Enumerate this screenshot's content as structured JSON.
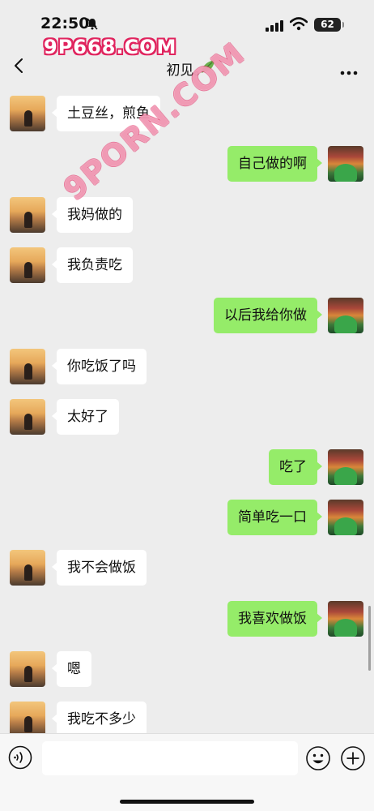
{
  "status_bar": {
    "time": "22:50",
    "battery": "62"
  },
  "watermarks": {
    "top": "9P668.COM",
    "diagonal": "9PORN.COM"
  },
  "header": {
    "title": "初见。"
  },
  "messages": [
    {
      "from": "them",
      "text": "土豆丝，煎鱼"
    },
    {
      "from": "me",
      "text": "自己做的啊"
    },
    {
      "from": "them",
      "text": "我妈做的"
    },
    {
      "from": "them",
      "text": "我负责吃"
    },
    {
      "from": "me",
      "text": "以后我给你做"
    },
    {
      "from": "them",
      "text": "你吃饭了吗"
    },
    {
      "from": "them",
      "text": "太好了"
    },
    {
      "from": "me",
      "text": "吃了"
    },
    {
      "from": "me",
      "text": "简单吃一口"
    },
    {
      "from": "them",
      "text": "我不会做饭"
    },
    {
      "from": "me",
      "text": "我喜欢做饭"
    },
    {
      "from": "them",
      "text": "嗯"
    },
    {
      "from": "them",
      "text": "我吃不多少"
    }
  ],
  "input_bar": {
    "placeholder": ""
  },
  "colors": {
    "background": "#ededed",
    "bubble_me": "#95ec69",
    "bubble_them": "#ffffff"
  },
  "icons": [
    "bell-slash-icon",
    "signal-icon",
    "wifi-icon",
    "battery-icon",
    "back-icon",
    "leaf-icon",
    "more-icon",
    "voice-icon",
    "emoji-icon",
    "plus-icon"
  ]
}
